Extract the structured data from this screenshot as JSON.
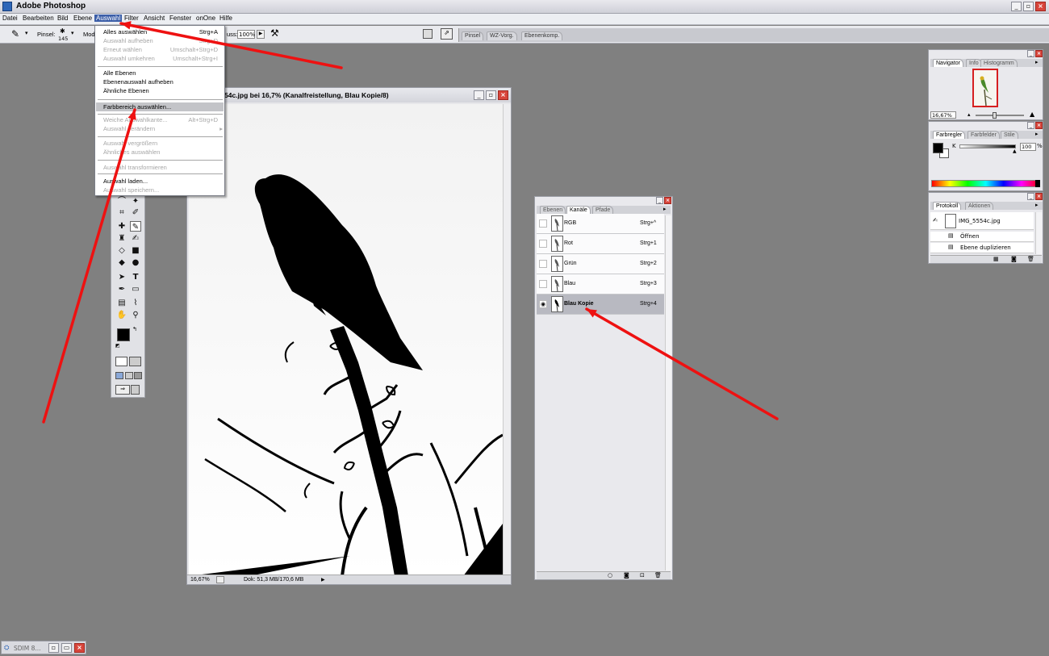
{
  "app": {
    "title": "Adobe Photoshop"
  },
  "menubar": {
    "items": [
      "Datei",
      "Bearbeiten",
      "Bild",
      "Ebene",
      "Auswahl",
      "Filter",
      "Ansicht",
      "Fenster",
      "onOne",
      "Hilfe"
    ],
    "active": "Auswahl"
  },
  "options": {
    "brush_label": "Pinsel:",
    "brush_size": "145",
    "mode_label": "Mod",
    "flow_label": "uss:",
    "flow_value": "100%"
  },
  "well_tabs": [
    "Pinsel",
    "WZ-Vorg.",
    "Ebenenkomp."
  ],
  "auswahl_menu": [
    {
      "label": "Alles auswählen",
      "shortcut": "Strg+A",
      "enabled": true
    },
    {
      "label": "Auswahl aufheben",
      "shortcut": "Strg+D",
      "enabled": false
    },
    {
      "label": "Erneut wählen",
      "shortcut": "Umschalt+Strg+D",
      "enabled": false
    },
    {
      "label": "Auswahl umkehren",
      "shortcut": "Umschalt+Strg+I",
      "enabled": false
    },
    {
      "label": "Alle Ebenen",
      "shortcut": "",
      "enabled": true
    },
    {
      "label": "Ebenenauswahl aufheben",
      "shortcut": "",
      "enabled": true
    },
    {
      "label": "Ähnliche Ebenen",
      "shortcut": "",
      "enabled": true
    },
    {
      "label": "Farbbereich auswählen...",
      "shortcut": "",
      "enabled": true,
      "highlighted": true
    },
    {
      "label": "Weiche Auswahlkante...",
      "shortcut": "Alt+Strg+D",
      "enabled": false
    },
    {
      "label": "Auswahl verändern",
      "shortcut": "",
      "enabled": false,
      "submenu": true
    },
    {
      "label": "Auswahl vergrößern",
      "shortcut": "",
      "enabled": false
    },
    {
      "label": "Ähnliches auswählen",
      "shortcut": "",
      "enabled": false
    },
    {
      "label": "Auswahl transformieren",
      "shortcut": "",
      "enabled": false
    },
    {
      "label": "Auswahl laden...",
      "shortcut": "",
      "enabled": true
    },
    {
      "label": "Auswahl speichern...",
      "shortcut": "",
      "enabled": false
    }
  ],
  "document": {
    "title": "54c.jpg bei 16,7% (Kanalfreistellung, Blau Kopie/8)",
    "zoom": "16,67%",
    "doc_info": "Dok: 51,3 MB/170,6 MB"
  },
  "channels_panel": {
    "tabs": [
      "Ebenen",
      "Kanäle",
      "Pfade"
    ],
    "active_tab": "Kanäle",
    "rows": [
      {
        "name": "RGB",
        "shortcut": "Strg+^"
      },
      {
        "name": "Rot",
        "shortcut": "Strg+1"
      },
      {
        "name": "Grün",
        "shortcut": "Strg+2"
      },
      {
        "name": "Blau",
        "shortcut": "Strg+3"
      },
      {
        "name": "Blau Kopie",
        "shortcut": "Strg+4",
        "selected": true
      }
    ]
  },
  "navigator_panel": {
    "tabs": [
      "Navigator",
      "Info",
      "Histogramm"
    ],
    "zoom": "16,67%"
  },
  "color_panel": {
    "tabs": [
      "Farbregler",
      "Farbfelder",
      "Stile"
    ],
    "channel": "K",
    "value": "100",
    "unit": "%"
  },
  "history_panel": {
    "tabs": [
      "Protokoll",
      "Aktionen"
    ],
    "snapshot": "IMG_5554c.jpg",
    "steps": [
      "Öffnen",
      "Ebene duplizieren"
    ]
  },
  "taskbar": {
    "label": "SDIM 8..."
  },
  "colors": {
    "annotation": "#ee1111",
    "menu_highlight": "#c3c4c8",
    "workspace": "#808080"
  }
}
